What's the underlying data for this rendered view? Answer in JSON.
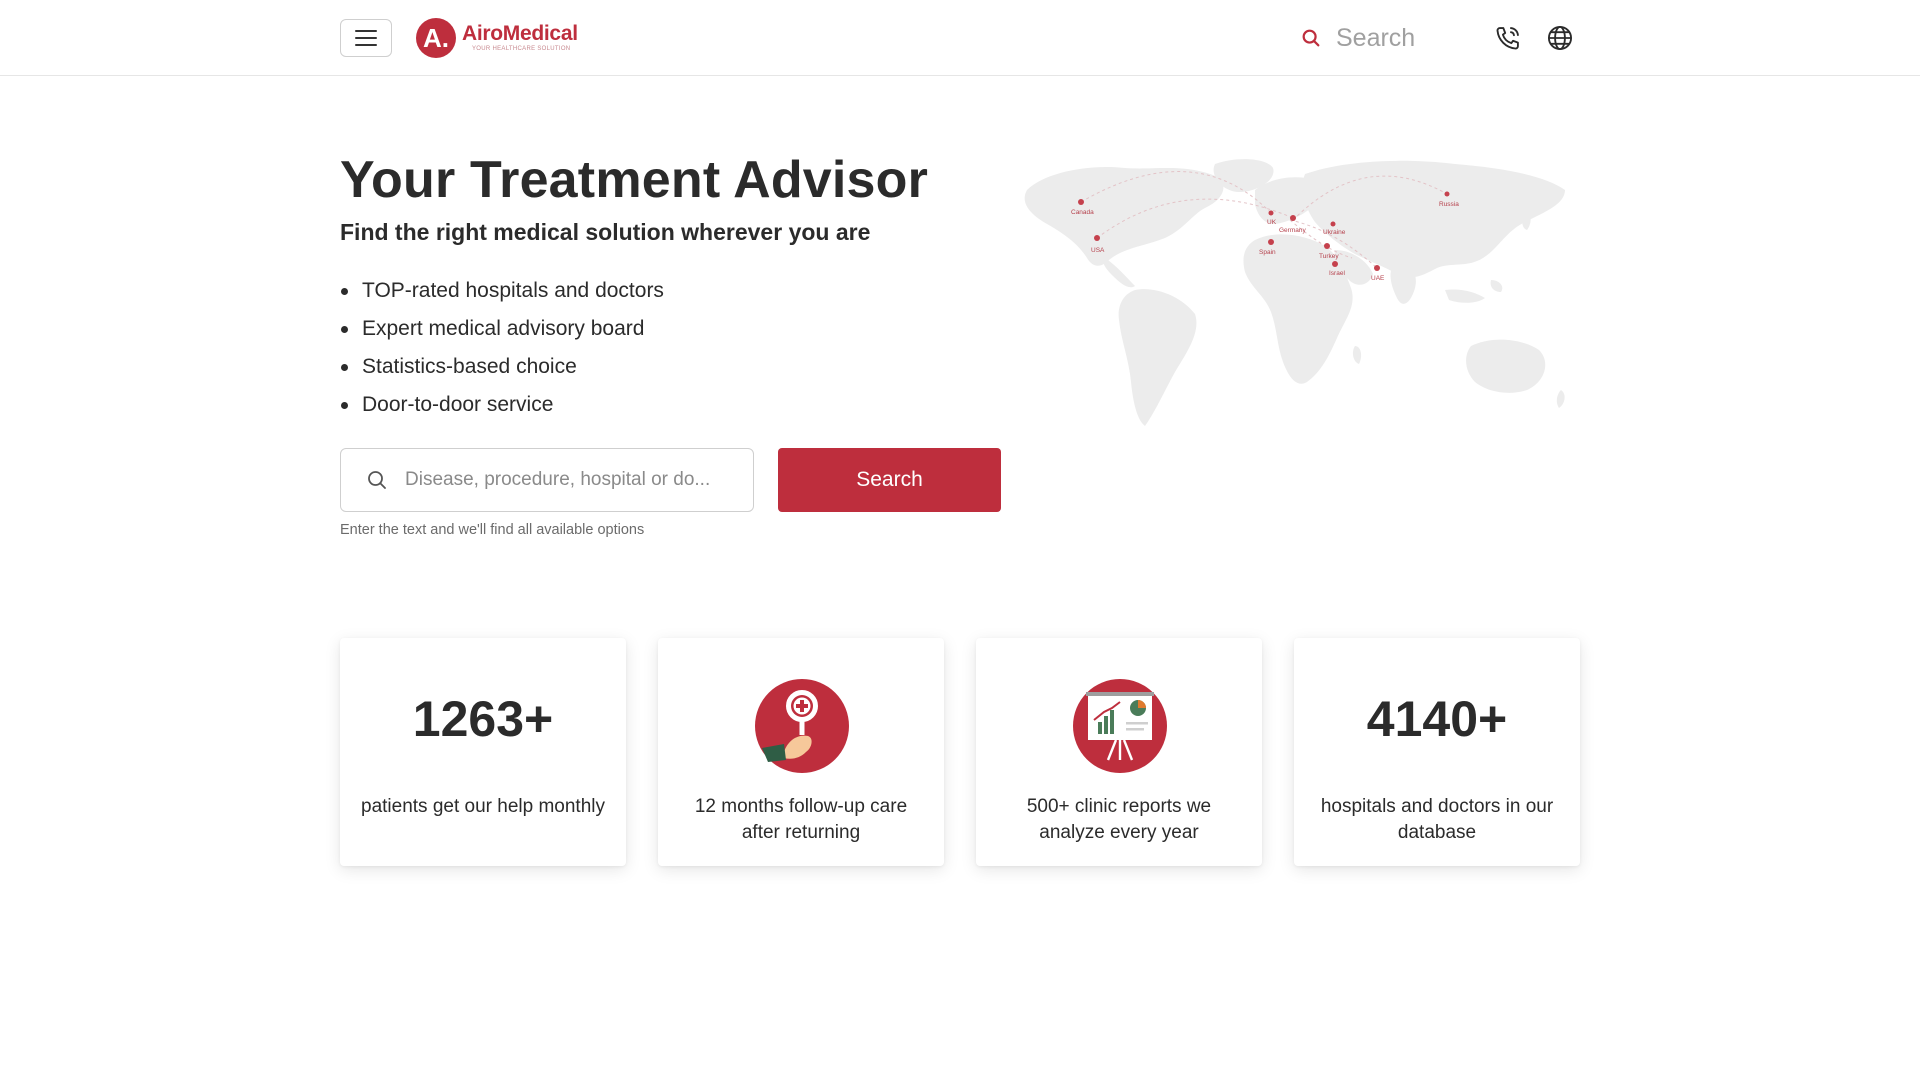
{
  "header": {
    "logo": {
      "mark": "A.",
      "name": "AiroMedical",
      "tagline": "YOUR HEALTHCARE SOLUTION"
    },
    "menu_icon": "hamburger-menu-icon",
    "search": {
      "icon": "search-icon",
      "placeholder": "Search"
    },
    "phone_icon": "phone-icon",
    "language_icon": "globe-icon"
  },
  "hero": {
    "title": "Your Treatment Advisor",
    "subtitle": "Find the right medical solution wherever you are",
    "features": [
      "TOP-rated hospitals and doctors",
      "Expert medical advisory board",
      "Statistics-based choice",
      "Door-to-door service"
    ],
    "search": {
      "placeholder": "Disease, procedure, hospital or do...",
      "button_label": "Search",
      "hint": "Enter the text and we'll find all available options"
    },
    "map": {
      "locations": [
        "Canada",
        "USA",
        "UK",
        "Germany",
        "Ukraine",
        "Russia",
        "Spain",
        "Turkey",
        "Israel",
        "UAE"
      ]
    }
  },
  "stats": [
    {
      "number": "1263+",
      "text": "patients get our help monthly"
    },
    {
      "icon": "medical-magnifier-icon",
      "text": "12 months follow-up care after returning"
    },
    {
      "icon": "chart-presentation-icon",
      "text": "500+ clinic reports we analyze every year"
    },
    {
      "number": "4140+",
      "text": "hospitals and doctors in our database"
    }
  ],
  "colors": {
    "brand": "#be2e3d",
    "text": "#2b2b2b",
    "map": "#ececec"
  }
}
